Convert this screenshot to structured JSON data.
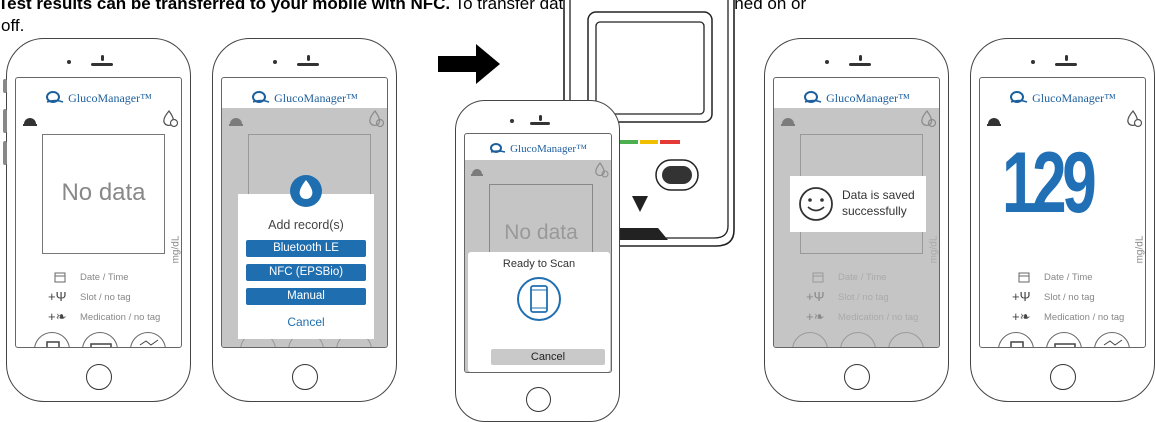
{
  "caption": {
    "line1_bold": "Test results can be transferred to your mobile with NFC.",
    "line1_rest": " To transfer data, the meter can be turned on or",
    "line2": "off."
  },
  "app": {
    "name": "GlucoManager™",
    "unit": "mg/dL",
    "no_data": "No data",
    "date_time": "Date / Time",
    "slot": "Slot / no tag",
    "medication": "Medication / no tag"
  },
  "add_dialog": {
    "title": "Add record(s)",
    "options": [
      "Bluetooth LE",
      "NFC (EPSBio)",
      "Manual"
    ],
    "cancel": "Cancel"
  },
  "scan_dialog": {
    "title": "Ready to Scan",
    "cancel": "Cancel"
  },
  "saved_dialog": {
    "line1": "Data is saved",
    "line2": "successfully"
  },
  "result": {
    "value": "129"
  },
  "colors": {
    "brand_blue": "#1d5f9e",
    "button_blue": "#1f6fb0",
    "reading_blue": "#2170b6"
  }
}
